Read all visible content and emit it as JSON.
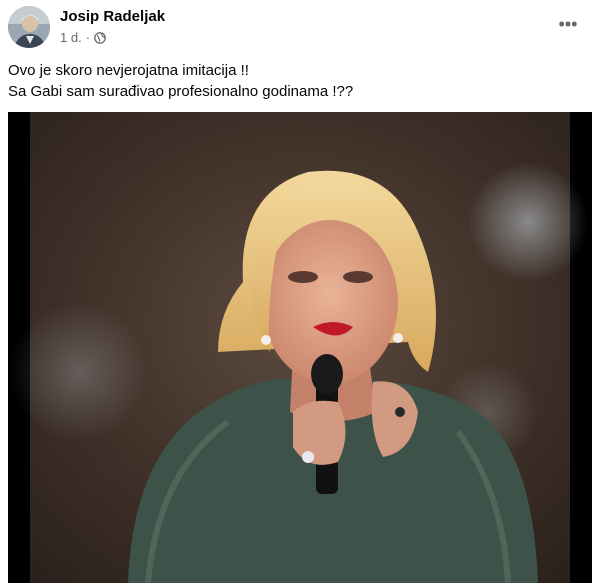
{
  "post": {
    "author": "Josip Radeljak",
    "time": "1 d.",
    "separator": "·",
    "privacy_icon": "globe-icon",
    "more_icon": "more-horizontal-icon",
    "more_label": "•••",
    "caption_lines": [
      "Ovo je skoro nevjerojatna imitacija !!",
      "Sa Gabi sam surađivao profesionalno godinama !??"
    ]
  },
  "colors": {
    "text_primary": "#050505",
    "text_secondary": "#65676b",
    "stage_background": "#4a3a30",
    "dress": "#3d5248",
    "hair": "#e8c27a"
  }
}
